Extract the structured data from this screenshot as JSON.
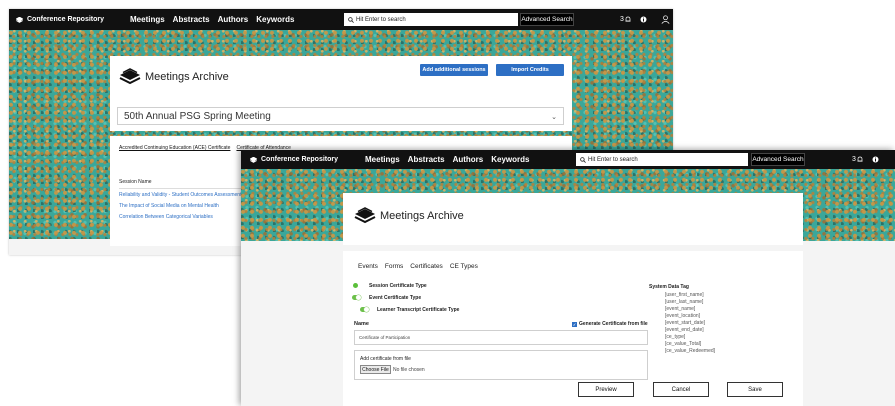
{
  "back_screen": {
    "navbar": {
      "brand": "Conference Repository",
      "links": [
        "Meetings",
        "Abstracts",
        "Authors",
        "Keywords"
      ],
      "search_placeholder": "Hit Enter to search",
      "advanced_search": "Advanced Search",
      "notification_count": "3"
    },
    "archive_title": "Meetings Archive",
    "buttons": {
      "add_sessions": "Add additional sessions",
      "import_credits": "Import Credits"
    },
    "meeting_select": "50th Annual PSG Spring Meeting",
    "cert_tabs": [
      "Accredited Continuing Education (ACE) Certificate",
      "Certificate of Attendance"
    ],
    "session_header": "Session Name",
    "sessions": [
      "Reliability and Validity - Student Outcomes Assessment",
      "The Impact of Social Media on Mental Health",
      "Correlation Between Categorical Variables"
    ]
  },
  "front_screen": {
    "navbar": {
      "brand": "Conference Repository",
      "links": [
        "Meetings",
        "Abstracts",
        "Authors",
        "Keywords"
      ],
      "search_placeholder": "Hit Enter to search",
      "advanced_search": "Advanced Search",
      "notification_count": "3"
    },
    "archive_title": "Meetings Archive",
    "tabs": [
      "Events",
      "Forms",
      "Certificates",
      "CE Types"
    ],
    "toggles": [
      "Session Certificate Type",
      "Event Certificate Type",
      "Learner Transcript Certificate Type"
    ],
    "name_label": "Name",
    "name_value": "Certificate of Participation",
    "generate_label": "Generate Certificate from file",
    "upload_label": "Add certificate from file",
    "choose_file": "Choose File",
    "no_file": "No file chosen",
    "system_tag_title": "System Data Tag",
    "system_tags": [
      "[user_first_name]",
      "[user_last_name]",
      "[event_name]",
      "[event_location]",
      "[event_start_date]",
      "[event_end_date]",
      "[ce_type]",
      "[ce_value_Total]",
      "[ce_value_Redeemed]"
    ],
    "buttons": {
      "preview": "Preview",
      "cancel": "Cancel",
      "save": "Save"
    }
  },
  "colors": {
    "navbar": "#111111",
    "accent_blue": "#2d6fc4",
    "toggle_green": "#6cc04a",
    "banner_teal": "#3aa79a"
  }
}
